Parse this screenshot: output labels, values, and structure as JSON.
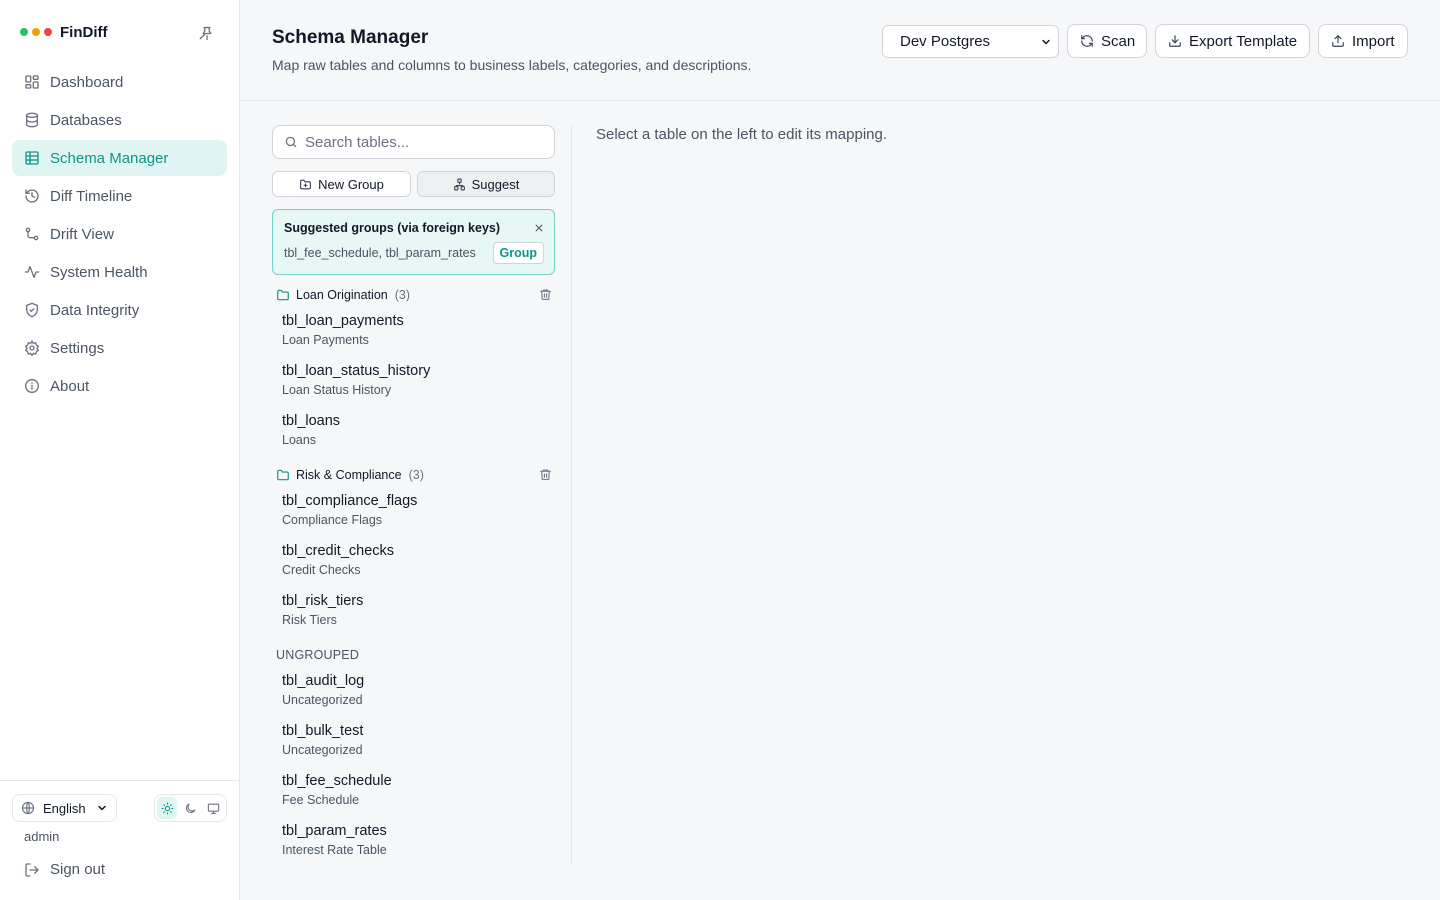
{
  "app": {
    "name": "FinDiff",
    "dot_colors": [
      "#22c55e",
      "#f59e0b",
      "#ef4444"
    ],
    "accent": "#0f9488",
    "pin_icon": "pin-icon"
  },
  "sidebar": {
    "items": [
      {
        "label": "Dashboard",
        "icon": "dashboard-icon",
        "active": false
      },
      {
        "label": "Databases",
        "icon": "database-icon",
        "active": false
      },
      {
        "label": "Schema Manager",
        "icon": "table-icon",
        "active": true
      },
      {
        "label": "Diff Timeline",
        "icon": "history-icon",
        "active": false
      },
      {
        "label": "Drift View",
        "icon": "git-branch-icon",
        "active": false
      },
      {
        "label": "System Health",
        "icon": "activity-icon",
        "active": false
      },
      {
        "label": "Data Integrity",
        "icon": "shield-check-icon",
        "active": false
      },
      {
        "label": "Settings",
        "icon": "gear-icon",
        "active": false
      },
      {
        "label": "About",
        "icon": "info-icon",
        "active": false
      }
    ],
    "language": "English",
    "theme_options": [
      "light",
      "dark",
      "system"
    ],
    "theme_selected": "light",
    "user": "admin",
    "sign_out": "Sign out"
  },
  "header": {
    "title": "Schema Manager",
    "subtitle": "Map raw tables and columns to business labels, categories, and descriptions.",
    "database_selected": "Dev Postgres",
    "scan_label": "Scan",
    "export_label": "Export Template",
    "import_label": "Import"
  },
  "panel": {
    "search_placeholder": "Search tables...",
    "new_group_label": "New Group",
    "suggest_label": "Suggest",
    "suggestion": {
      "title": "Suggested groups (via foreign keys)",
      "tables": "tbl_fee_schedule, tbl_param_rates",
      "action": "Group"
    },
    "groups": [
      {
        "name": "Loan Origination",
        "count": "(3)",
        "tables": [
          {
            "name": "tbl_loan_payments",
            "label": "Loan Payments"
          },
          {
            "name": "tbl_loan_status_history",
            "label": "Loan Status History"
          },
          {
            "name": "tbl_loans",
            "label": "Loans"
          }
        ]
      },
      {
        "name": "Risk & Compliance",
        "count": "(3)",
        "tables": [
          {
            "name": "tbl_compliance_flags",
            "label": "Compliance Flags"
          },
          {
            "name": "tbl_credit_checks",
            "label": "Credit Checks"
          },
          {
            "name": "tbl_risk_tiers",
            "label": "Risk Tiers"
          }
        ]
      }
    ],
    "ungrouped_label": "UNGROUPED",
    "ungrouped": [
      {
        "name": "tbl_audit_log",
        "label": "Uncategorized"
      },
      {
        "name": "tbl_bulk_test",
        "label": "Uncategorized"
      },
      {
        "name": "tbl_fee_schedule",
        "label": "Fee Schedule"
      },
      {
        "name": "tbl_param_rates",
        "label": "Interest Rate Table"
      }
    ]
  },
  "detail": {
    "hint": "Select a table on the left to edit its mapping."
  }
}
